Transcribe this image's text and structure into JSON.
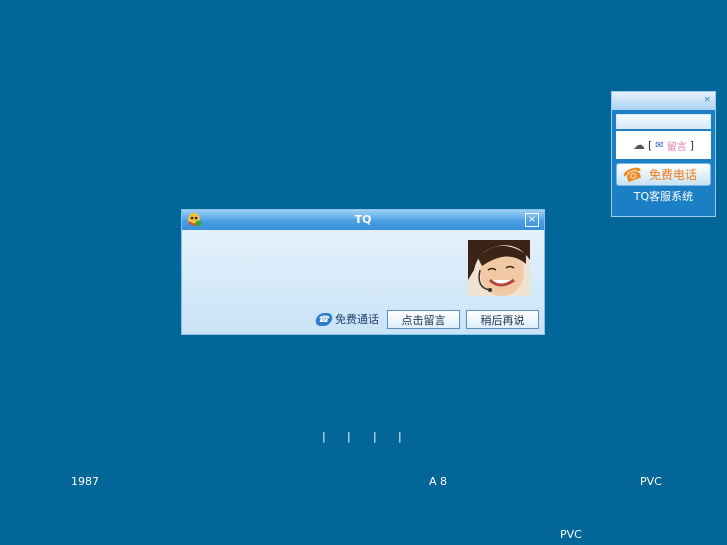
{
  "side_widget": {
    "close_glyph": "×",
    "message_open": "[",
    "mail_icon": "✉",
    "message_label": "留言",
    "message_close": "]",
    "call_label": "免费电话",
    "footer": "TQ客服系统"
  },
  "dialog": {
    "title": "TQ",
    "close_glyph": "×",
    "free_call_label": "免费通话",
    "leave_message_button": "点击留言",
    "later_button": "稍后再说"
  },
  "page_text": {
    "separators": [
      "|",
      "|",
      "|",
      "|"
    ],
    "year": "1987",
    "code": "A 8",
    "material_right": "PVC",
    "material_bottom": "PVC"
  },
  "colors": {
    "background": "#036699",
    "accent_orange": "#f07a10"
  }
}
